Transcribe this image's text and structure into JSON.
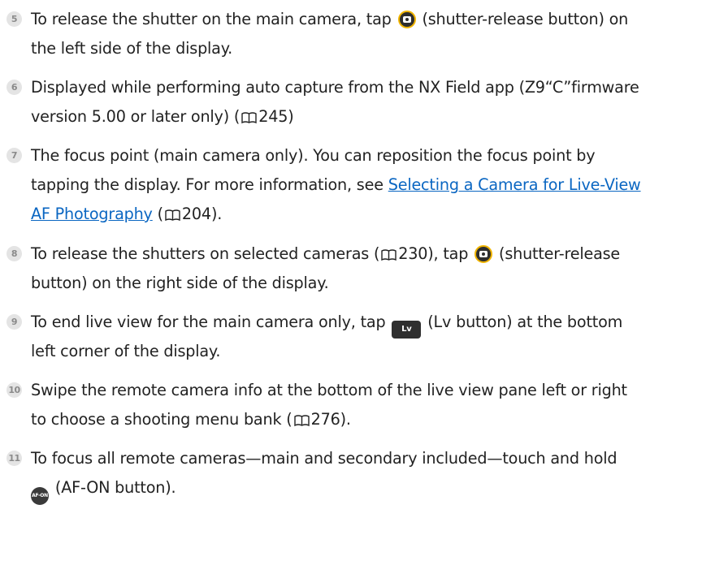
{
  "items": [
    {
      "number": "5",
      "line1_a": "To release the shutter on the main camera, tap",
      "icon1": "shutter-release-icon",
      "line1_b": "(shutter-release button) on",
      "line2": "the left side of the display."
    },
    {
      "number": "6",
      "line1": "Displayed while performing auto capture from the NX Field app (Z9“C”firmware",
      "line2_a": "version 5.00 or later only) (",
      "ref": "245",
      "line2_b": ")"
    },
    {
      "number": "7",
      "line1": "The focus point (main camera only). You can reposition the focus point by",
      "line2_a": "tapping the display. For more information, see",
      "link_part1": "Selecting a Camera for Live-View",
      "link_part2": "AF Photography",
      "ref": "204",
      "line3_b": ")."
    },
    {
      "number": "8",
      "line1_a": "To release the shutters on selected cameras (",
      "ref": "230",
      "line1_b": "), tap",
      "line1_c": "(shutter-release",
      "line2": "button) on the right side of the display."
    },
    {
      "number": "9",
      "line1_a": "To end live view for the main camera only, tap",
      "lv_label": "Lv",
      "line1_b": "(Lv button) at the bottom",
      "line2": "left corner of the display."
    },
    {
      "number": "10",
      "line1": "Swipe the remote camera info at the bottom of the live view pane left or right",
      "line2_a": "to choose a shooting menu bank (",
      "ref": "276",
      "line2_b": ")."
    },
    {
      "number": "11",
      "line1": "To focus all remote cameras—main and secondary included—touch and hold",
      "afon_label": "AF-ON",
      "line2": "(AF-ON button)."
    }
  ],
  "icons": {
    "book": "book-reference-icon",
    "shutter": "shutter-release-icon",
    "lv": "lv-button-icon",
    "afon": "af-on-button-icon"
  },
  "colors": {
    "link": "#0a66c2",
    "shutter_ring": "#f0b400",
    "number_bg": "#e4e4e4"
  }
}
